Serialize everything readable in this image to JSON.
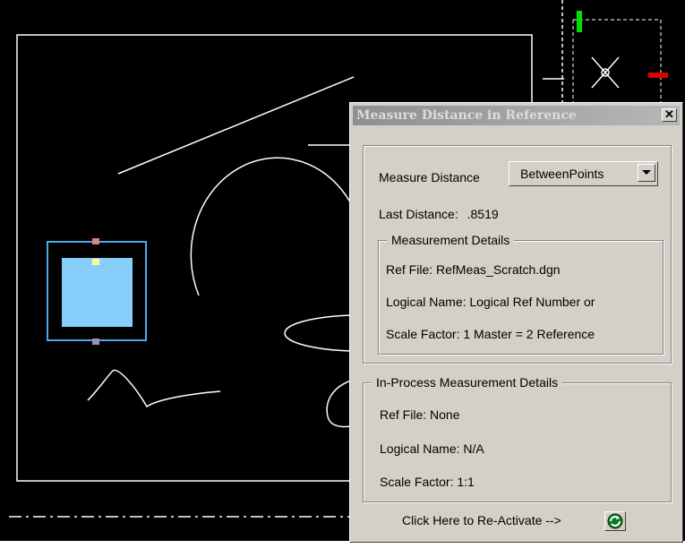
{
  "dialog": {
    "title": "Measure Distance in Reference",
    "close_label": "✕",
    "measure_label": "Measure Distance",
    "measure_mode": "BetweenPoints",
    "last_distance_label": "Last Distance:",
    "last_distance_value": ".8519",
    "details": {
      "legend": "Measurement Details",
      "ref_file": "Ref File: RefMeas_Scratch.dgn",
      "logical_name": "Logical Name: Logical Ref Number or",
      "scale_factor": "Scale Factor: 1 Master =  2 Reference"
    },
    "in_process": {
      "legend": "In-Process Measurement Details",
      "ref_file": "Ref File: None",
      "logical_name": "Logical Name: N/A",
      "scale_factor": "Scale Factor: 1:1"
    },
    "reactivate_label": "Click Here to Re-Activate -->"
  },
  "colors": {
    "canvas_bg": "#000000",
    "dialog_bg": "#d4d0c8",
    "selection_fill": "#87cefa",
    "selection_border": "#4fa8e8",
    "green_handle": "#00e000",
    "red_handle": "#e00000"
  },
  "icons": {
    "reactivate": "green-refresh-icon",
    "close": "close-icon",
    "dropdown": "chevron-down-icon"
  }
}
